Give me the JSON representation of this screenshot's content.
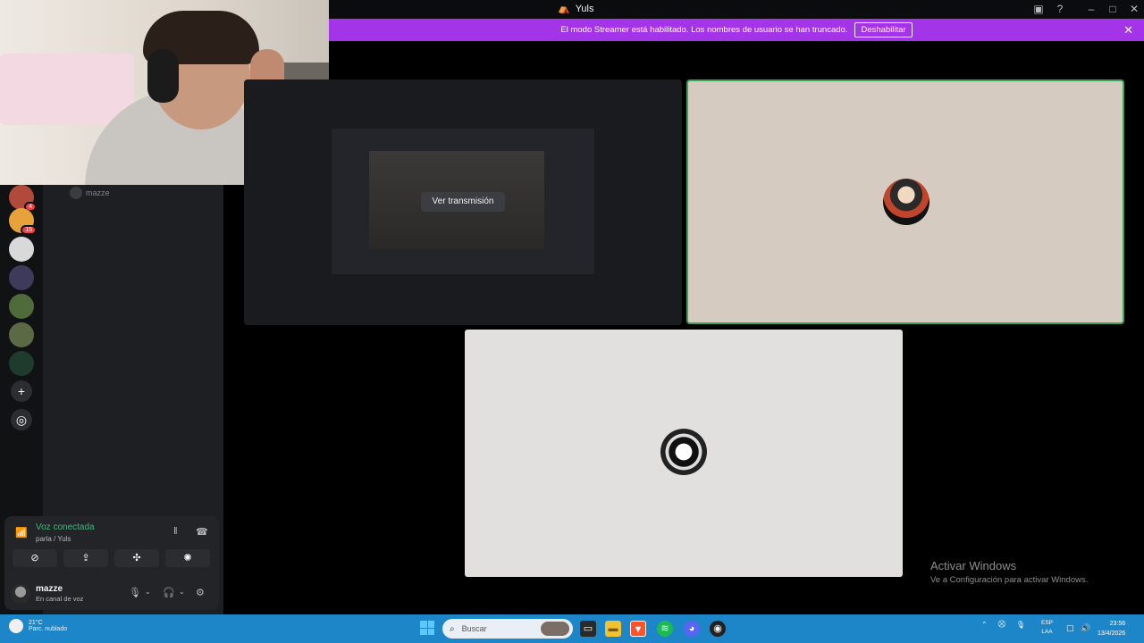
{
  "window": {
    "title": "Yuls"
  },
  "banner": {
    "message": "El modo Streamer está habilitado. Los nombres de usuario se han truncado.",
    "button": "Deshabilitar"
  },
  "sidebar": {
    "member_name": "mazze",
    "servers": [
      {
        "badge": "4"
      },
      {
        "badge": "15"
      },
      {
        "badge": ""
      },
      {
        "badge": ""
      },
      {
        "badge": ""
      },
      {
        "badge": ""
      },
      {
        "badge": ""
      }
    ]
  },
  "voice": {
    "status": "Voz conectada",
    "channel": "parla / Yuls",
    "user_name": "mazze",
    "user_status": "En canal de voz"
  },
  "stage": {
    "watch_button": "Ver transmisión"
  },
  "activate_windows": {
    "heading": "Activar Windows",
    "subtext": "Ve a Configuración para activar Windows."
  },
  "taskbar": {
    "weather_temp": "21°C",
    "weather_desc": "Parc. nublado",
    "search_placeholder": "Buscar",
    "lang_1": "ESP",
    "lang_2": "LAA",
    "time": "23:56",
    "date": "13/4/2026"
  },
  "colors": {
    "banner": "#a334e8",
    "speaking_border": "#3ba55c",
    "taskbar": "#1c86c9",
    "voice_connected": "#43b581"
  }
}
